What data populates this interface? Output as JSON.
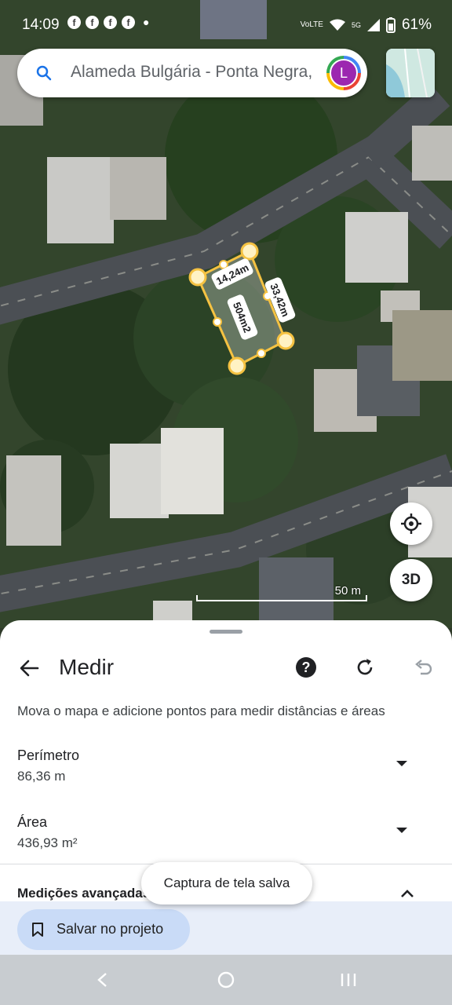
{
  "status_bar": {
    "time": "14:09",
    "network": "VoLTE",
    "signal": "5G",
    "battery": "61%",
    "notification_icons": [
      "facebook-icon",
      "facebook-icon",
      "facebook-icon",
      "facebook-icon"
    ]
  },
  "search": {
    "query": "Alameda Bulgária - Ponta Negra, Manaus",
    "avatar_letter": "L"
  },
  "map": {
    "measurement": {
      "side_top": "14,24m",
      "side_right": "33,42m",
      "area_label": "504m2"
    },
    "scale_label": "50 m",
    "btn_3d": "3D"
  },
  "sheet": {
    "title": "Medir",
    "description": "Mova o mapa e adicione pontos para medir distâncias e áreas",
    "perimeter_label": "Perímetro",
    "perimeter_value": "86,36 m",
    "area_label": "Área",
    "area_value": "436,93 m²",
    "advanced_label": "Medições avançadas",
    "save_label": "Salvar no projeto"
  },
  "toast": "Captura de tela salva",
  "colors": {
    "accent_blue": "#1a73e8",
    "avatar_purple": "#9c27b0",
    "measure_yellow": "#f5c242",
    "save_button_bg": "#c9dbf7"
  }
}
